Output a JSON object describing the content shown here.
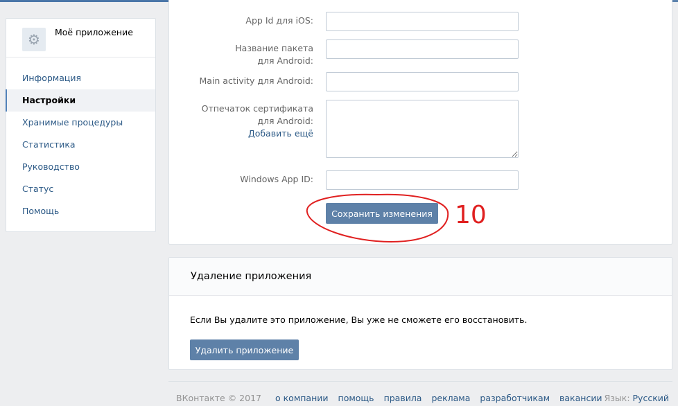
{
  "sidebar": {
    "app_name": "Моё приложение",
    "icon": "gear-icon",
    "items": [
      {
        "label": "Информация",
        "active": false
      },
      {
        "label": "Настройки",
        "active": true
      },
      {
        "label": "Хранимые процедуры",
        "active": false
      },
      {
        "label": "Статистика",
        "active": false
      },
      {
        "label": "Руководство",
        "active": false
      },
      {
        "label": "Статус",
        "active": false
      },
      {
        "label": "Помощь",
        "active": false
      }
    ]
  },
  "settings": {
    "ios_app_id_label": "App Id для iOS:",
    "android_package_label_1": "Название пакета",
    "android_package_label_2": "для Android:",
    "android_activity_label": "Main activity для Android:",
    "android_cert_label_1": "Отпечаток сертификата",
    "android_cert_label_2": "для Android:",
    "add_more_link": "Добавить ещё",
    "windows_app_id_label": "Windows App ID:",
    "save_button": "Сохранить изменения",
    "annotation_text": "10"
  },
  "delete_section": {
    "title": "Удаление приложения",
    "warning": "Если Вы удалите это приложение, Вы уже не сможете его восстановить.",
    "delete_button": "Удалить приложение"
  },
  "footer": {
    "copyright": "ВКонтакте © 2017",
    "links": [
      "о компании",
      "помощь",
      "правила",
      "реклама",
      "разработчикам",
      "вакансии"
    ],
    "language_label": "Язык:",
    "language_value": "Русский"
  },
  "colors": {
    "accent": "#4a76a8",
    "button": "#5e81a8",
    "link": "#2a5885",
    "annotation": "#e02020"
  }
}
